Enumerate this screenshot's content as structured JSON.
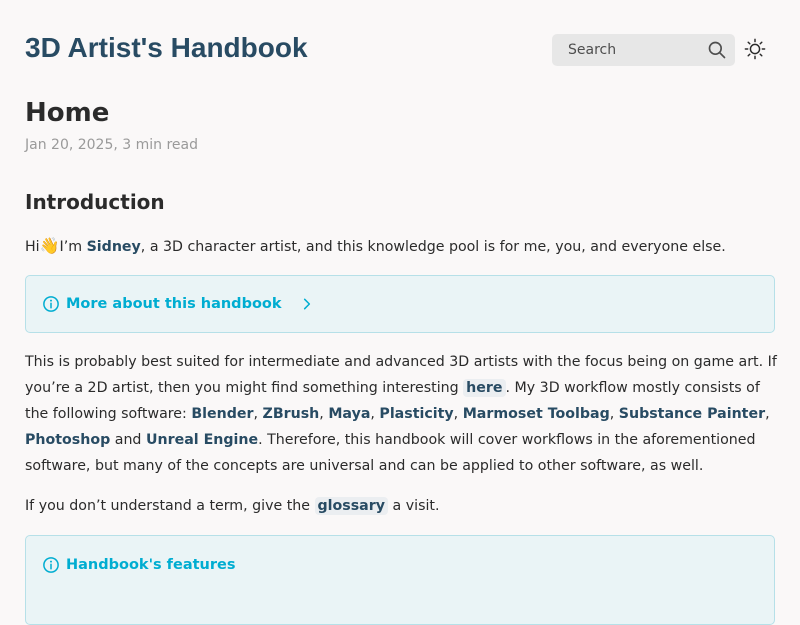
{
  "header": {
    "site_title": "3D Artist's Handbook",
    "search_placeholder": "Search",
    "search_icon": "search-icon",
    "theme_icon": "sun-icon"
  },
  "page": {
    "title": "Home",
    "meta": "Jan 20, 2025, 3 min read"
  },
  "intro": {
    "heading": "Introduction",
    "p1_before": "Hi",
    "wave": "👋",
    "p1_mid": "I’m ",
    "p1_link": "Sidney",
    "p1_after": ", a 3D character artist, and this knowledge pool is for me, you, and everyone else."
  },
  "callouts": [
    {
      "title": "More about this handbook",
      "collapsed": true
    },
    {
      "title": "Handbook's features"
    }
  ],
  "p2": {
    "t1": "This is probably best suited for intermediate and advanced 3D artists with the focus being on game art. If you’re a 2D artist, then you might find something interesting ",
    "here": "here",
    "t2": ". My 3D workflow mostly consists of the following software: ",
    "blender": "Blender",
    "zbrush": "ZBrush",
    "maya": "Maya",
    "plasticity": "Plasticity",
    "marmoset": "Marmoset Toolbag",
    "substance": "Substance Painter",
    "photoshop": "Photoshop",
    "and": " and ",
    "unreal": "Unreal Engine",
    "t3": ". Therefore, this handbook will cover workflows in the aforementioned software, but many of the concepts are universal and can be applied to other software, as well.",
    "sep": ", "
  },
  "p3": {
    "t1": "If you don’t understand a term, give the ",
    "glossary": "glossary",
    "t2": " a visit."
  },
  "colors": {
    "link": "#284b63",
    "callout_accent": "#00add1",
    "callout_bg": "#eaf4f6"
  }
}
